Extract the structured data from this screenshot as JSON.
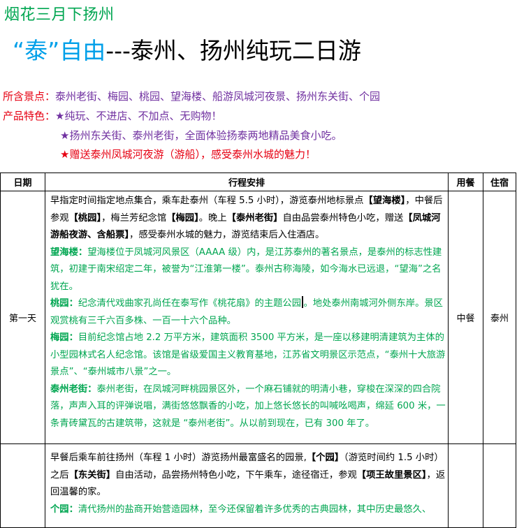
{
  "header": {
    "subtitle": "烟花三月下扬州",
    "title_quote": "“泰”自由",
    "title_rest": "---泰州、扬州纯玩二日游"
  },
  "info": {
    "spots_label": "所含景点：",
    "spots": "泰州老街、梅园、桃园、望海楼、船游凤城河夜景、扬州东关街、个园",
    "feature_label": "产品特色：",
    "feature_1": "★纯玩、不进店、不加点、无购物！",
    "feature_2": "★扬州东关街、泰州老街，全面体验扬泰两地精品美食小吃。",
    "feature_3": "★赠送泰州凤城河夜游（游船），感受泰州水城的魅力！"
  },
  "table": {
    "headers": [
      "日期",
      "行程安排",
      "用餐",
      "住宿"
    ],
    "day1": {
      "date": "第一天",
      "meal": "中餐",
      "stay": "泰州",
      "p1_a": "早指定时间指定地点集合，乘车赴泰州（车程 5.5 小时），游览泰州地标景点",
      "p1_b": "【望海楼】",
      "p1_c": "，中餐后参观",
      "p1_d": "【桃园】",
      "p1_e": "，梅兰芳纪念馆",
      "p1_f": "【梅园】",
      "p1_g": "。晚上",
      "p1_h": "【泰州老街】",
      "p1_i": "自由品尝泰州特色小吃，赠送",
      "p1_j": "【凤城河游船夜游、含船票】",
      "p1_k": "，感受泰州水城的魅力，游览结束后入住酒店。",
      "p2_label": "望海楼：",
      "p2_text": "望海楼位于凤城河风景区（AAAA 级）内，是江苏泰州的著名景点，是泰州的标志性建筑，初建于南宋绍定二年，被誉为“江淮第一楼”。泰州古称海陵，如今海水已远退，“望海”之名犹在。",
      "p3_label": "桃园：",
      "p3_text_a": "纪念清代戏曲家孔尚任在泰写作《桃花扇》的主题公园",
      "p3_text_b": "。地处泰州南城河外侧东岸。景区观赏桃有三千六百多株、一百一十六个品种。",
      "p4_label": "梅园：",
      "p4_text": "目前纪念馆占地 2.2 万平方米，建筑面积 3500 平方米，是一座以移建明清建筑为主体的小型园林式名人纪念馆。该馆是省级爱国主义教育基地，江苏省文明景区示范点，“泰州十大旅游景点”、“泰州城市八景”之一。",
      "p5_label": "泰州老街：",
      "p5_text": "泰州老街，在凤城河畔桃园景区外，一个麻石铺就的明清小巷，穿梭在深深的四合院落，声声入耳的评弹说唱，满街悠悠飘香的小吃，加上悠长悠长的叫喊吆喝声，绵延 600 米，一条青砖黛瓦的古建筑带，这就是 “泰州老街”。从以前到现在，已有 300 年了。"
    },
    "day2": {
      "p1_a": "早餐后乘车前往扬州（车程 1 小时）游览扬州最富盛名的园景,",
      "p1_b": "【个园】",
      "p1_c": "（游览时间约 1.5 小时）之后",
      "p1_d": "【东关街】",
      "p1_e": "自由活动，品尝扬州特色小吃，下午乘车，途径宿迁，参观",
      "p1_f": "【项王故里景区】",
      "p1_g": "，返回温馨的家。",
      "p2_label": "个园：",
      "p2_text": "清代扬州的盐商开始营造园林，至今还保留着许多优秀的古典园林，其中历史最悠久、"
    }
  }
}
